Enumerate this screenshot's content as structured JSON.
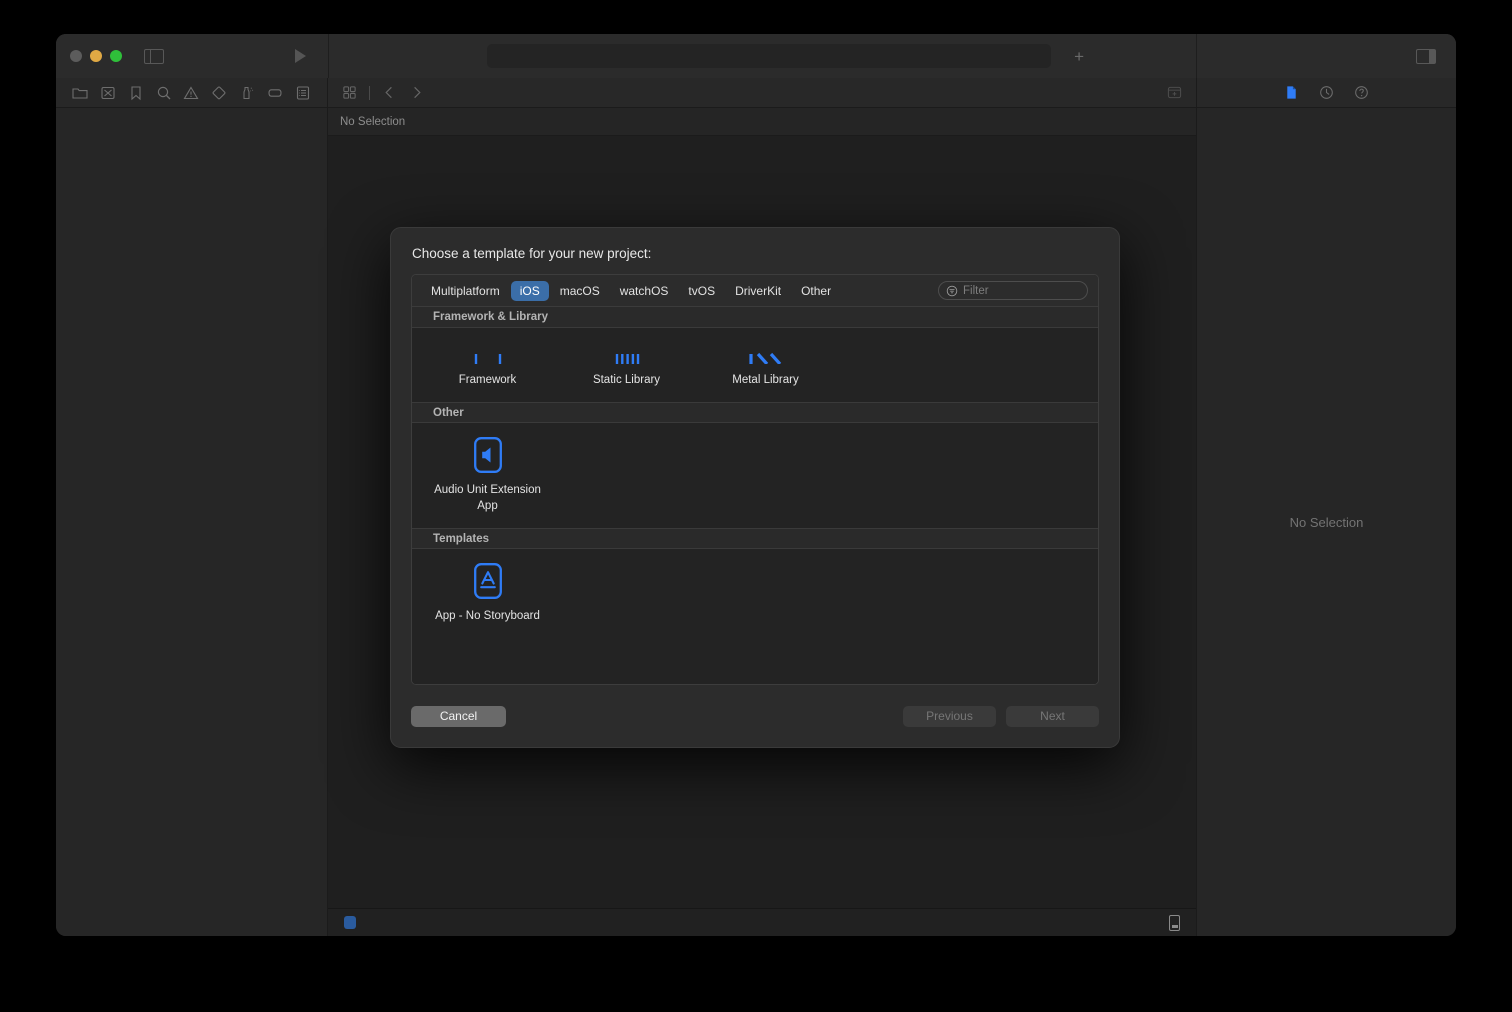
{
  "window": {
    "traffic_lights": [
      "close",
      "minimize",
      "zoom"
    ],
    "sidebar_toggle_icon": "sidebar-left-icon",
    "run_icon": "run-play-icon",
    "add_icon": "plus-icon",
    "inspector_toggle_icon": "sidebar-right-icon"
  },
  "navigator": {
    "icons": [
      "folder-project-navigator-icon",
      "source-control-navigator-icon",
      "bookmark-navigator-icon",
      "search-navigator-icon",
      "issue-warning-navigator-icon",
      "test-diamond-navigator-icon",
      "debug-navigator-icon",
      "breakpoint-navigator-icon",
      "report-navigator-icon"
    ]
  },
  "editor": {
    "grid_icon": "editor-grid-icon",
    "back_icon": "chevron-left-icon",
    "forward_icon": "chevron-right-icon",
    "add_editor_icon": "add-editor-icon",
    "jump_bar_text": "No Selection"
  },
  "status_bar": {
    "left_indicator_icon": "build-status-icon",
    "right_device_icon": "device-icon"
  },
  "inspector": {
    "icons": [
      "file-inspector-icon",
      "history-inspector-icon",
      "quick-help-inspector-icon"
    ],
    "selected_icon": "file-inspector-icon",
    "empty_text": "No Selection"
  },
  "dialog": {
    "title": "Choose a template for your new project:",
    "platform_tabs": [
      {
        "label": "Multiplatform",
        "selected": false
      },
      {
        "label": "iOS",
        "selected": true
      },
      {
        "label": "macOS",
        "selected": false
      },
      {
        "label": "watchOS",
        "selected": false
      },
      {
        "label": "tvOS",
        "selected": false
      },
      {
        "label": "DriverKit",
        "selected": false
      },
      {
        "label": "Other",
        "selected": false
      }
    ],
    "filter": {
      "placeholder": "Filter",
      "value": "",
      "icon": "filter-circle-icon"
    },
    "sections": [
      {
        "header": "Framework & Library",
        "clipped": true,
        "templates": [
          {
            "label": "Framework",
            "icon": "framework-icon"
          },
          {
            "label": "Static Library",
            "icon": "static-library-icon"
          },
          {
            "label": "Metal Library",
            "icon": "metal-library-icon"
          }
        ]
      },
      {
        "header": "Other",
        "clipped": false,
        "templates": [
          {
            "label": "Audio Unit Extension App",
            "icon": "audio-unit-icon"
          }
        ]
      },
      {
        "header": "Templates",
        "clipped": false,
        "templates": [
          {
            "label": "App - No Storyboard",
            "icon": "app-store-icon"
          }
        ]
      }
    ],
    "buttons": {
      "cancel": "Cancel",
      "previous": "Previous",
      "next": "Next"
    }
  },
  "colors": {
    "accent_blue": "#2f7cf6",
    "tab_selected": "#3b6ea8",
    "dialog_bg": "#2c2c2c",
    "panel_bg": "#232323",
    "window_bg": "#262626"
  }
}
